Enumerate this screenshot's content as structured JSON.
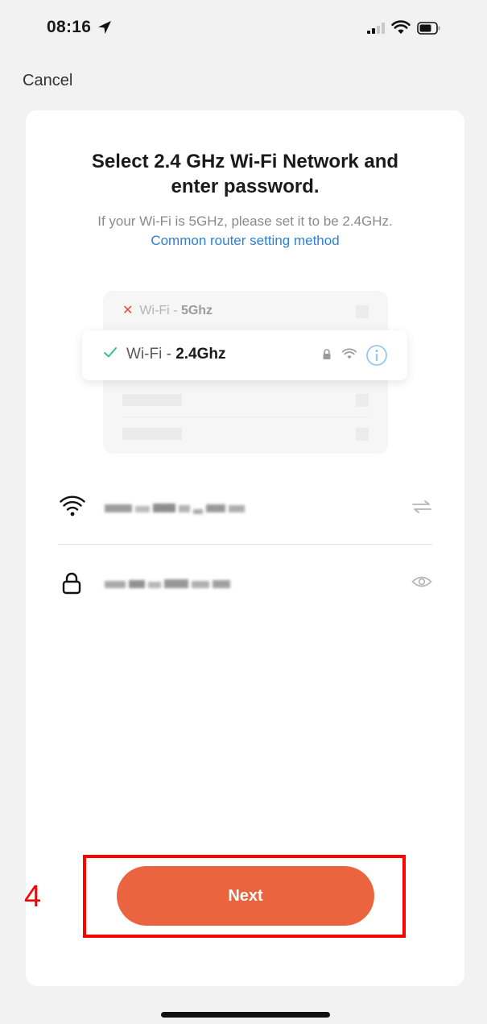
{
  "status_bar": {
    "time": "08:16"
  },
  "nav": {
    "cancel_label": "Cancel"
  },
  "heading": {
    "title": "Select 2.4 GHz Wi-Fi Network and\nenter password.",
    "hint": "If your Wi-Fi is 5GHz, please set it to be 2.4GHz.",
    "link": "Common router setting method"
  },
  "illustration": {
    "row_5g_prefix": "Wi-Fi - ",
    "row_5g_band": "5Ghz",
    "row_24g_prefix": "Wi-Fi - ",
    "row_24g_band": "2.4Ghz"
  },
  "form": {
    "ssid_icon": "wifi-icon",
    "ssid_switch_icon": "switch-network-icon",
    "password_icon": "lock-icon",
    "password_toggle_icon": "eye-icon"
  },
  "actions": {
    "next_label": "Next"
  },
  "annotation": {
    "step_number": "4"
  },
  "colors": {
    "accent": "#ea653f",
    "link": "#2d80d6",
    "annotation": "#ff0000",
    "check": "#3cbf8d",
    "cross": "#e84a35"
  }
}
